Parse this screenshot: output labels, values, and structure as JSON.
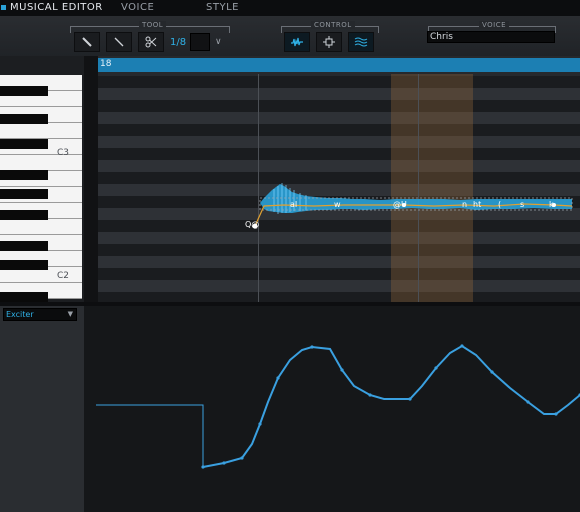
{
  "tabs": [
    {
      "label": "MUSICAL EDITOR",
      "active": true
    },
    {
      "label": "VOICE",
      "active": false
    },
    {
      "label": "STYLE",
      "active": false
    }
  ],
  "toolbar": {
    "tool_group_label": "TOOL",
    "control_group_label": "CONTROL",
    "voice_group_label": "VOICE",
    "quantize_value": "1/8",
    "quantize_arrow": "∨",
    "voice_value": "Chris"
  },
  "piano_roll": {
    "ruler_text": "18",
    "key_labels": [
      "C3",
      "C2"
    ],
    "phonemes": [
      "Q@",
      "aI",
      "w",
      "@U",
      "n",
      "ht",
      "(",
      "s",
      "k"
    ]
  },
  "control_panel": {
    "parameter": "Exciter"
  },
  "colors": {
    "accent": "#2aa2d8",
    "ruler": "#1c7fb3",
    "loop_region": "#8a6a45",
    "pitch_line": "#e0a030",
    "curve": "#3aa0e0"
  }
}
